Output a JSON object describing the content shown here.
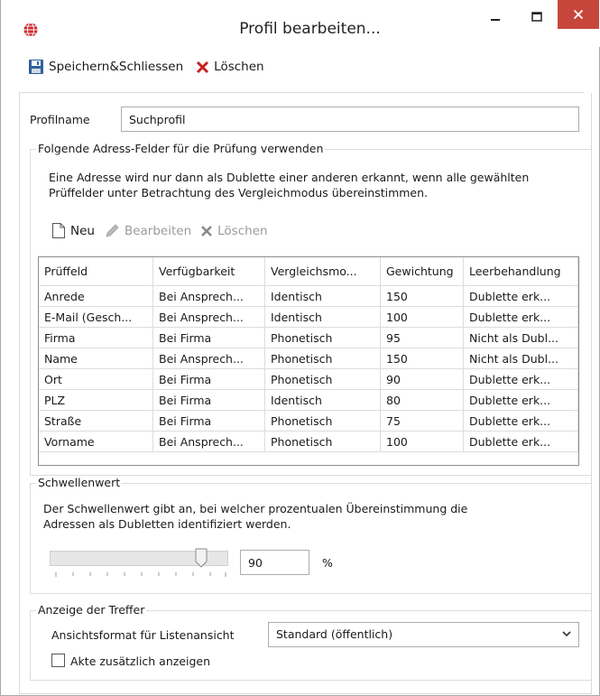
{
  "window": {
    "title": "Profil bearbeiten...",
    "app_icon": "globe-icon",
    "controls": {
      "minimize": "–",
      "maximize": "☐",
      "close": "✕"
    },
    "close_color": "#c7463c"
  },
  "toolbar": {
    "save_close_label": "Speichern&Schliessen",
    "save_icon": "floppy-disk-icon",
    "delete_label": "Löschen",
    "delete_icon": "red-x-icon"
  },
  "profile": {
    "label": "Profilname",
    "value": "Suchprofil"
  },
  "fields_group": {
    "title": "Folgende Adress-Felder für die Prüfung verwenden",
    "description_line1": "Eine Adresse wird nur dann als Dublette einer anderen erkannt, wenn alle gewählten",
    "description_line2": "Prüffelder unter Betrachtung des Vergleichmodus übereinstimmen.",
    "actions": {
      "new_label": "Neu",
      "edit_label": "Bearbeiten",
      "delete_label": "Löschen"
    },
    "table": {
      "columns": [
        "Prüffeld",
        "Verfügbarkeit",
        "Vergleichsmo...",
        "Gewichtung",
        "Leerbehandlung"
      ],
      "rows": [
        [
          "Anrede",
          "Bei Ansprech...",
          "Identisch",
          "150",
          "Dublette erk..."
        ],
        [
          "E-Mail (Gesch...",
          "Bei Ansprech...",
          "Identisch",
          "100",
          "Dublette erk..."
        ],
        [
          "Firma",
          "Bei Firma",
          "Phonetisch",
          "95",
          "Nicht als Dubl..."
        ],
        [
          "Name",
          "Bei Ansprech...",
          "Phonetisch",
          "150",
          "Nicht als Dubl..."
        ],
        [
          "Ort",
          "Bei Firma",
          "Phonetisch",
          "90",
          "Dublette erk..."
        ],
        [
          "PLZ",
          "Bei Firma",
          "Identisch",
          "80",
          "Dublette erk..."
        ],
        [
          "Straße",
          "Bei Firma",
          "Phonetisch",
          "75",
          "Dublette erk..."
        ],
        [
          "Vorname",
          "Bei Ansprech...",
          "Phonetisch",
          "100",
          "Dublette erk..."
        ]
      ]
    }
  },
  "threshold_group": {
    "title": "Schwellenwert",
    "description_line1": "Der Schwellenwert gibt an, bei welcher prozentualen Übereinstimmung die",
    "description_line2": "Adressen als Dubletten identifiziert werden.",
    "value": "90",
    "unit": "%",
    "slider_fraction": 0.9
  },
  "display_group": {
    "title": "Anzeige der Treffer",
    "format_label": "Ansichtsformat für Listenansicht",
    "format_value": "Standard (öffentlich)",
    "checkbox_label": "Akte zusätzlich anzeigen",
    "checkbox_checked": false
  }
}
